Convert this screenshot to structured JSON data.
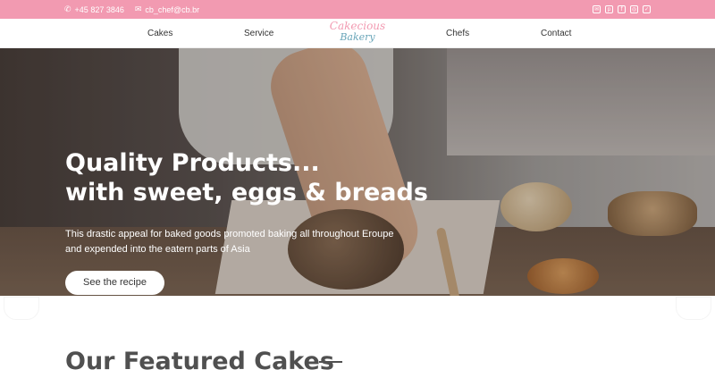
{
  "topbar": {
    "phone": "+45 827 3846",
    "email": "cb_chef@cb.br",
    "socials": [
      {
        "icon": "email-icon",
        "glyph": "✉"
      },
      {
        "icon": "pinterest-icon",
        "glyph": "p"
      },
      {
        "icon": "facebook-icon",
        "glyph": "f"
      },
      {
        "icon": "instagram-icon",
        "glyph": "◎"
      },
      {
        "icon": "twitter-icon",
        "glyph": "✓"
      }
    ]
  },
  "nav": {
    "links": [
      "Cakes",
      "Service",
      "Chefs",
      "Contact"
    ],
    "logo_line1": "Cakecious",
    "logo_line2": "Bakery"
  },
  "hero": {
    "title_line1": "Quality Products...",
    "title_line2": "with sweet, eggs & breads",
    "text": "This drastic appeal for baked goods promoted baking all throughout Eroupe and expended into the eatern parts of Asia",
    "button": "See the recipe"
  },
  "featured": {
    "title": "Our Featured Cakes"
  },
  "colors": {
    "accent": "#f29ab1",
    "logo_secondary": "#6aa6b9",
    "heading": "#505050"
  }
}
